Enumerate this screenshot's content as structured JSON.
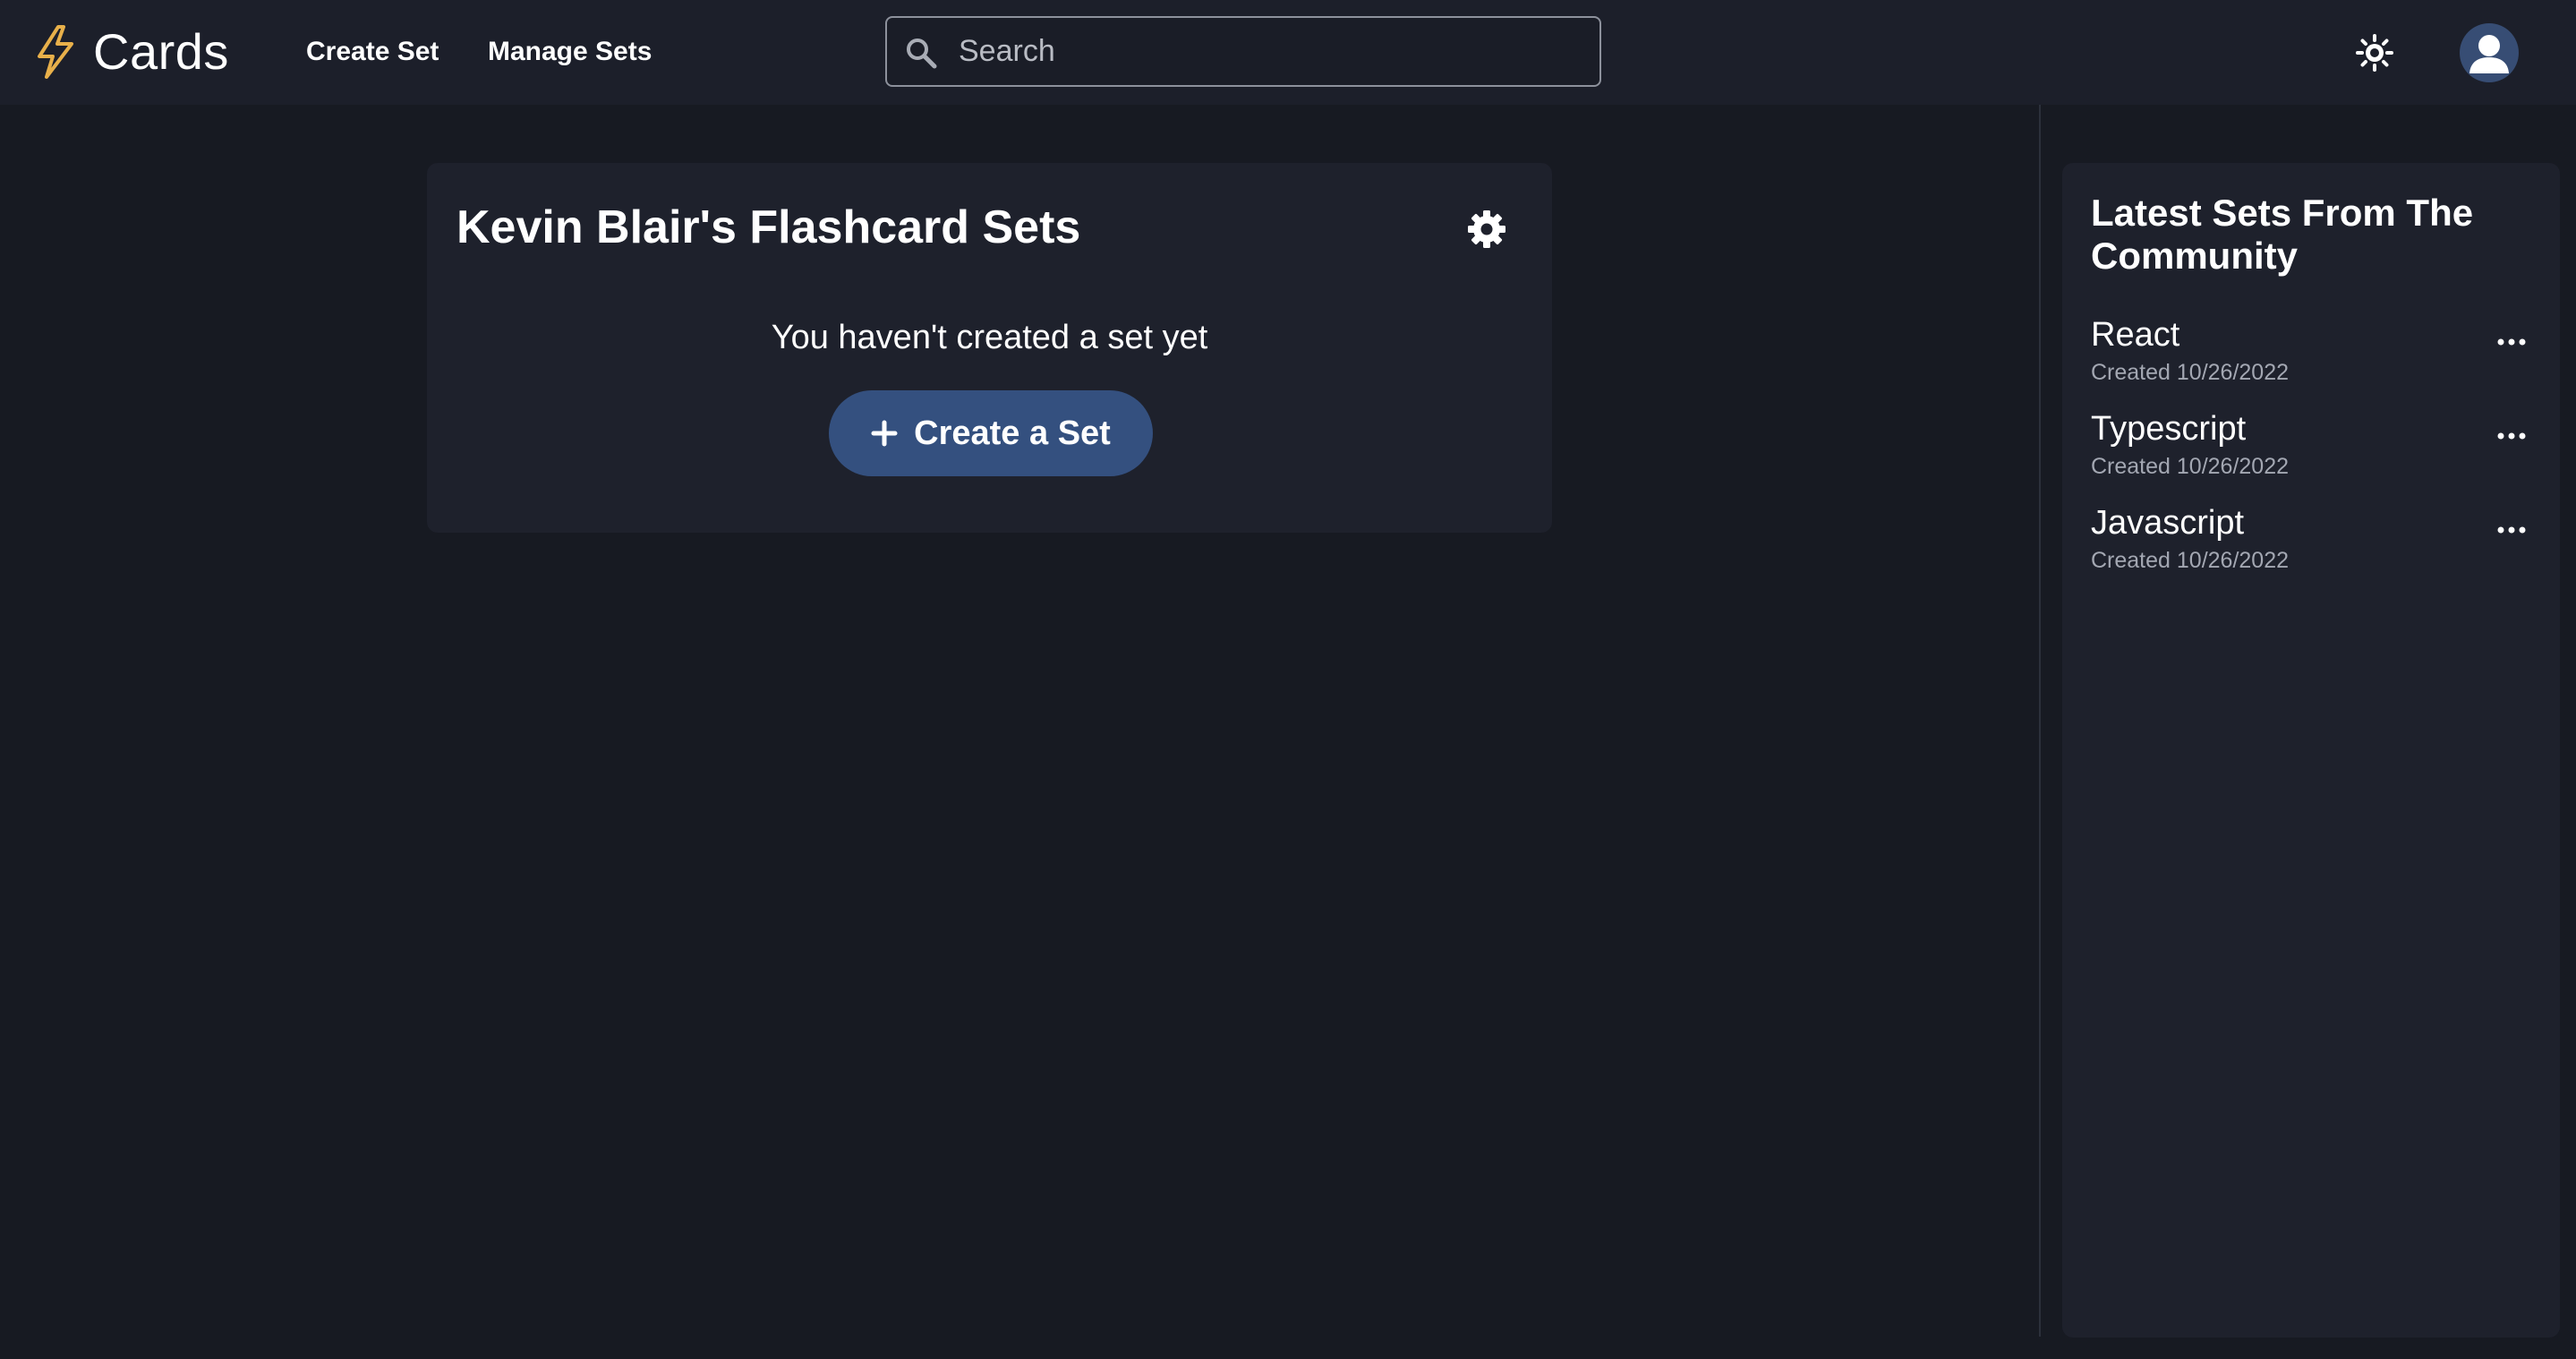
{
  "header": {
    "logo_text": "Cards",
    "nav": {
      "create_set": "Create Set",
      "manage_sets": "Manage Sets"
    },
    "search": {
      "placeholder": "Search",
      "value": ""
    }
  },
  "main": {
    "title": "Kevin Blair's Flashcard Sets",
    "empty_message": "You haven't created a set yet",
    "create_button_label": "Create a Set"
  },
  "sidebar": {
    "title": "Latest Sets From The Community",
    "sets": [
      {
        "name": "React",
        "created": "Created 10/26/2022"
      },
      {
        "name": "Typescript",
        "created": "Created 10/26/2022"
      },
      {
        "name": "Javascript",
        "created": "Created 10/26/2022"
      }
    ]
  },
  "icons": {
    "logo": "lightning-bolt-icon",
    "search": "search-icon",
    "theme": "sun-icon",
    "avatar": "user-icon",
    "settings": "gear-icon",
    "create": "plus-icon",
    "more": "more-horizontal-icon"
  },
  "colors": {
    "background": "#171a22",
    "header": "#1c1f2a",
    "card": "#1e212c",
    "accent_button": "#34507f",
    "logo_accent": "#e8b04a",
    "muted_text": "#a3a7b2"
  }
}
